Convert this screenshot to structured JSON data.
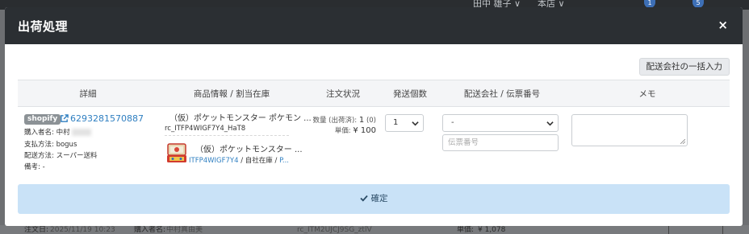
{
  "background": {
    "topbar": {
      "user": "田中 雄子 ∨",
      "store": "本店 ∨",
      "badges": [
        "1",
        "5"
      ]
    },
    "row": {
      "order_date_label": "注文日:",
      "order_date": "2025/11/19 10:23",
      "buyer_label": "購入者名:",
      "buyer": "中村真由美",
      "sku": "rc_ITM2UJCJ9SG_ztlV",
      "price_label": "単価:",
      "price": "¥ 1,078"
    }
  },
  "modal": {
    "title": "出荷処理",
    "close": "×",
    "bulk_carrier_button": "配送会社の一括入力",
    "columns": [
      "詳細",
      "商品情報 / 割当在庫",
      "注文状況",
      "発送個数",
      "配送会社 / 伝票番号",
      "メモ"
    ],
    "order": {
      "platform": "shopify",
      "order_number": "6293281570887",
      "buyer_label": "購入者名:",
      "buyer": "中村",
      "payment": "支払方法: bogus",
      "shipping_method": "配送方法: スーパー送料",
      "remarks": "備考: -"
    },
    "product": {
      "title": "（仮）ポケットモンスター ポケモン ...",
      "sku": "rc_ITFP4WIGF7Y4_HaT8",
      "stock_title": "（仮）ポケットモンスター ...",
      "stock_code": "ITFP4WIGF7Y4",
      "stock_sep": " / 自社在庫 / ",
      "stock_more": "P..."
    },
    "status": {
      "qty_label": "数量 (出荷済):",
      "qty": "1",
      "shipped": "(0)",
      "price_label": "単価:",
      "price": "¥ 100"
    },
    "ship_qty": "1",
    "carrier": "-",
    "tracking_placeholder": "伝票番号",
    "confirm_button": "確定",
    "colors": {
      "header": "#2b2f33",
      "link": "#2f7fc1",
      "confirm_bg": "#c9e2f7"
    }
  }
}
